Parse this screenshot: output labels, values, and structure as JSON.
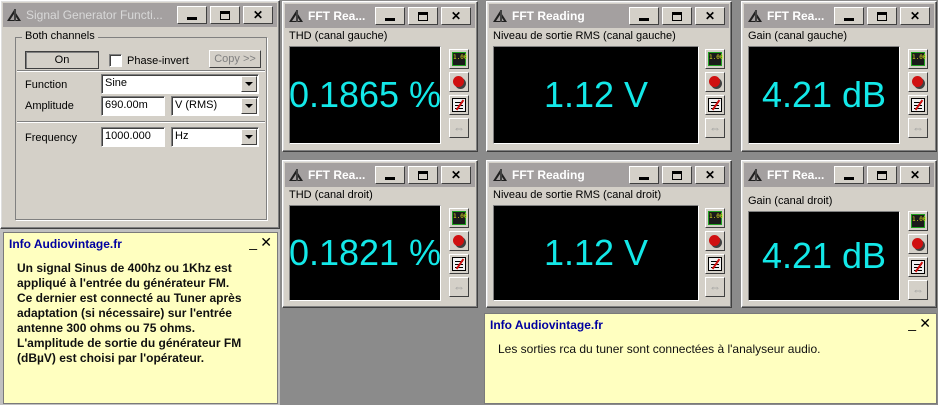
{
  "signal_generator": {
    "title": "Signal Generator Functi...",
    "group_label": "Both channels",
    "on_button": "On",
    "phase_invert": {
      "label": "Phase-invert",
      "checked": false
    },
    "copy_button": "Copy >>",
    "function": {
      "label": "Function",
      "value": "Sine"
    },
    "amplitude": {
      "label": "Amplitude",
      "value": "690.00m",
      "unit": "V (RMS)"
    },
    "frequency": {
      "label": "Frequency",
      "value": "1000.000",
      "unit": "Hz"
    }
  },
  "windows": [
    {
      "title": "FFT Rea...",
      "caption": "THD (canal gauche)",
      "value": "0.1865 %"
    },
    {
      "title": "FFT Reading",
      "caption": "Niveau de sortie RMS  (canal gauche)",
      "value": "1.12 V"
    },
    {
      "title": "FFT Rea...",
      "caption": "Gain (canal gauche)",
      "value": "4.21 dB"
    },
    {
      "title": "FFT Rea...",
      "caption": "THD (canal droit)",
      "value": "0.1821 %"
    },
    {
      "title": "FFT Reading",
      "caption": "Niveau de sortie RMS (canal droit)",
      "value": "1.12 V"
    },
    {
      "title": "FFT Rea...",
      "caption": "Gain (canal droit)",
      "value": "4.21 dB"
    }
  ],
  "side_buttons": [
    "numeric-display-icon",
    "record-icon",
    "settings-icon",
    "grow-icon"
  ],
  "info_left": {
    "title": "Info Audiovintage.fr",
    "body": "Un signal Sinus de 400hz ou 1Khz  est\nappliqué à l'entrée du générateur FM.\nCe dernier est connecté au Tuner après\nadaptation (si nécessaire) sur l'entrée\nantenne 300 ohms ou 75 ohms.\nL'amplitude de sortie du générateur FM\n(dBµV) est choisi par l'opérateur."
  },
  "info_right": {
    "title": "Info Audiovintage.fr",
    "body": "Les sorties rca du tuner sont connectées à l'analyseur audio."
  },
  "colors": {
    "display_text": "#13e8e8",
    "display_bg": "#000000",
    "info_bg": "#ffffc0",
    "info_title": "#0000a0"
  }
}
